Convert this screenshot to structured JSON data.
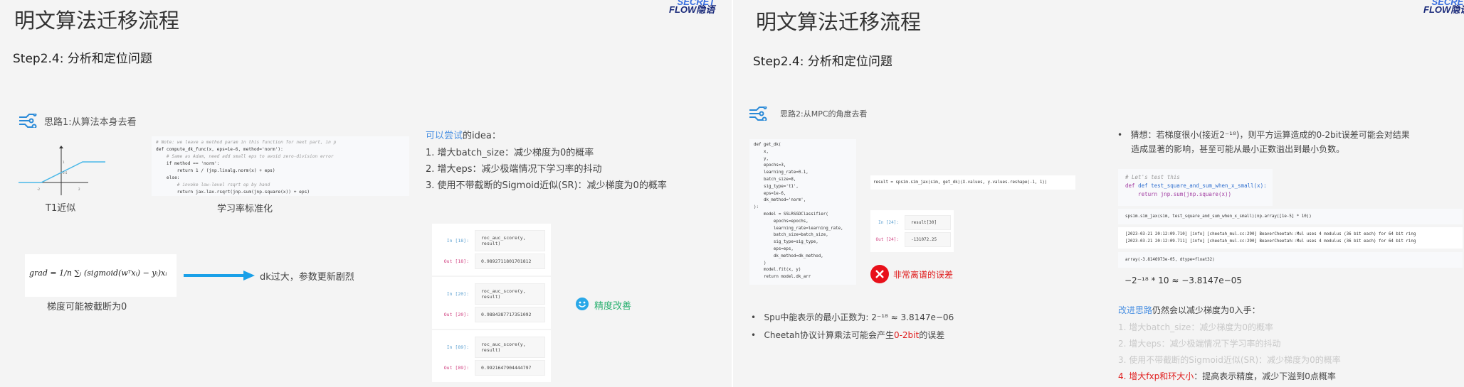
{
  "left": {
    "title": "明文算法迁移流程",
    "logo_top": "SECRET",
    "logo_bottom": "FLOW隐语",
    "step": "Step2.4: 分析和定位问题",
    "idea_heading": "思路1:从算法本身去看",
    "graph": {
      "y1": "1",
      "y05": "0.5",
      "x_neg2": "-2",
      "x_2": "2"
    },
    "t1_label": "T1近似",
    "lr_label": "学习率标准化",
    "code": [
      "# Note: we leave a method param in this function for next part, in p",
      "def compute_dk_func(x, eps=1e-6, method='norm'):",
      "    # Same as Adam, need add small eps to avoid zero-division error",
      "    if method == 'norm':",
      "        return 1 / (jnp.linalg.norm(x) + eps)",
      "    else:",
      "        # invoke low-level rsqrt op by hand",
      "        return jax.lax.rsqrt(jnp.sum(jnp.square(x)) + eps)"
    ],
    "formula": "grad = 1/n ∑ᵢ (sigmoid(wᵀxᵢ) − yᵢ)xᵢ",
    "arrow_text": "dk过大，参数更新剧烈",
    "clip_text": "梯度可能被截断为0",
    "try_prefix": "可以尝试",
    "try_suffix": "的idea：",
    "items": [
      "1.  增大batch_size：减少梯度为0的概率",
      "2.  增大eps：减少极端情况下学习率的抖动",
      "3.  使用不带截断的Sigmoid近似(SR)：减少梯度为0的概率"
    ],
    "cells": [
      {
        "in": "In [18]:",
        "src": "roc_auc_score(y, result)",
        "out": "Out [18]:",
        "val": "0.9892711801701812"
      },
      {
        "in": "In [20]:",
        "src": "roc_auc_score(y, result)",
        "out": "Out [20]:",
        "val": "0.9884387717351092"
      },
      {
        "in": "In [89]:",
        "src": "roc_auc_score(y, result)",
        "out": "Out [89]:",
        "val": "0.9921647904444797"
      }
    ],
    "improve": "精度改善"
  },
  "right": {
    "title": "明文算法迁移流程",
    "logo_top": "SECRET",
    "logo_bottom": "FLOW隐语",
    "step": "Step2.4: 分析和定位问题",
    "idea_heading": "思路2:从MPC的角度去看",
    "code": [
      "def get_dk(",
      "    x,",
      "    y,",
      "    epochs=3,",
      "    learning_rate=0.1,",
      "    batch_size=8,",
      "    sig_type='t1',",
      "    eps=1e-6,",
      "    dk_method='norm',",
      "):",
      "    model = SSLRSGDClassifier(",
      "        epochs=epochs,",
      "        learning_rate=learning_rate,",
      "        batch_size=batch_size,",
      "        sig_type=sig_type,",
      "        eps=eps,",
      "        dk_method=dk_method,",
      "    )",
      "    model.fit(x, y)",
      "    return model.dk_arr"
    ],
    "result_line": "result = spsim.sim_jax(sim, get_dk)(X.values, y.values.reshape(-1, 1))",
    "cell": {
      "in": "In [24]:",
      "src": "result[30]",
      "out": "Out [24]:",
      "val": "-131072.25"
    },
    "error": "非常离谱的误差",
    "bullets": [
      {
        "a": "Spu中能表示的最小正数为: 2⁻¹⁸ ≈ 3.8147e−06",
        "b": "",
        "c": ""
      },
      {
        "a": "Cheetah协议计算乘法可能会产生",
        "b": "0-2bit",
        "c": "的误差"
      }
    ],
    "guess": [
      "猜想：若梯度很小(接近2⁻¹⁸)，则平方运算造成的0-2bit误差可能会对结果",
      "造成显著的影响，甚至可能从最小正数溢出到最小负数。"
    ],
    "code2": [
      "# Let's test this",
      "def test_square_and_sum_when_x_small(x):",
      "    return jnp.sum(jnp.square(x))"
    ],
    "sim_line": "spsim.sim_jax(sim, test_square_and_sum_when_x_small)(np.array([1e-5] * 10))",
    "logs": [
      "[2023-03-21 20:12:09.710] [info] [cheetah_mul.cc:290] BeaverCheetah::Mul uses 4 modulus (36 bit each) for 64 bit ring",
      "[2023-03-21 20:12:09.711] [info] [cheetah_mul.cc:290] BeaverCheetah::Mul uses 4 modulus (36 bit each) for 64 bit ring"
    ],
    "array_out": "array(-3.8146973e-05, dtype=float32)",
    "formula": "−2⁻¹⁸ * 10 ≈ −3.8147e−05",
    "improve_prefix": "改进思路",
    "improve_suffix": "仍然会以减少梯度为0入手：",
    "items": [
      "1.  增大batch_size：减少梯度为0的概率",
      "2.  增大eps：减少极端情况下学习率的抖动",
      "3.  使用不带截断的Sigmoid近似(SR)：减少梯度为0的概率"
    ],
    "item4_red": "4.  增大fxp和环大小",
    "item4_rest": "：提高表示精度，减少下溢到0点概率"
  }
}
